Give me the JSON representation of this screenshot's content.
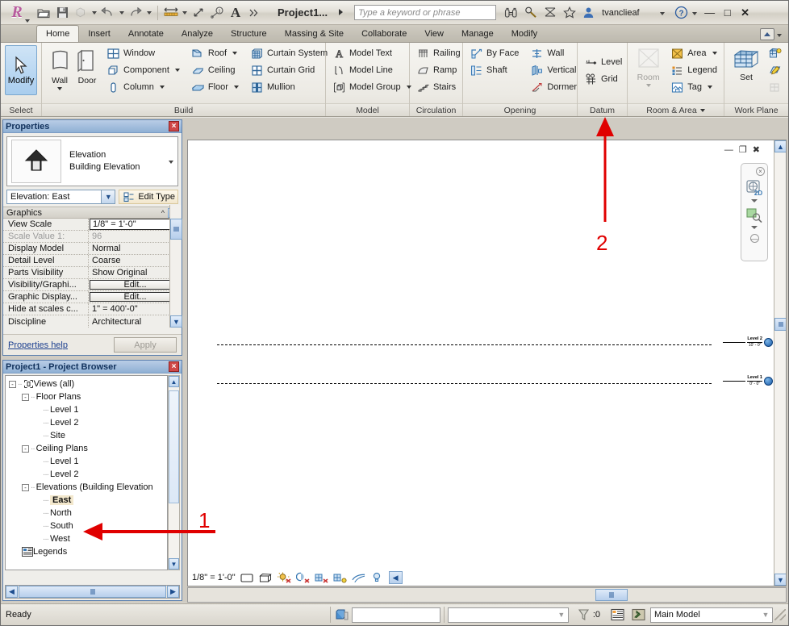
{
  "titlebar": {
    "app_menu": "R",
    "qat": [
      {
        "name": "open-icon",
        "label": "Open"
      },
      {
        "name": "save-icon",
        "label": "Save"
      },
      {
        "name": "sync-icon",
        "label": "Synchronize with Central"
      },
      {
        "name": "undo-icon",
        "label": "Undo"
      },
      {
        "name": "redo-icon",
        "label": "Redo"
      },
      {
        "name": "measure-icon",
        "label": "Measure"
      },
      {
        "name": "aligned-dimension-icon",
        "label": "Aligned Dimension"
      },
      {
        "name": "tag-icon",
        "label": "Tag by Category"
      },
      {
        "name": "text-icon",
        "label": "Text"
      },
      {
        "name": "more-icon",
        "label": "More"
      }
    ],
    "document_title": "Project1...",
    "search_placeholder": "Type a keyword or phrase",
    "icons": [
      {
        "name": "binoculars-icon"
      },
      {
        "name": "search-icon"
      },
      {
        "name": "subscription-icon"
      },
      {
        "name": "star-icon"
      }
    ],
    "user": "tvanclieaf",
    "help_label": "?",
    "window_buttons": [
      "minimize",
      "maximize",
      "close"
    ]
  },
  "tabs": [
    {
      "label": "Home",
      "active": true
    },
    {
      "label": "Insert",
      "active": false
    },
    {
      "label": "Annotate",
      "active": false
    },
    {
      "label": "Analyze",
      "active": false
    },
    {
      "label": "Structure",
      "active": false
    },
    {
      "label": "Massing & Site",
      "active": false
    },
    {
      "label": "Collaborate",
      "active": false
    },
    {
      "label": "View",
      "active": false
    },
    {
      "label": "Manage",
      "active": false
    },
    {
      "label": "Modify",
      "active": false
    }
  ],
  "ribbon": {
    "panels": [
      {
        "title": "Select",
        "big": [
          {
            "label": "Modify",
            "icon": "cursor-icon",
            "active": true
          }
        ],
        "columns": []
      },
      {
        "title": "Build",
        "big": [
          {
            "label": "Wall",
            "icon": "wall-icon",
            "dropdown": true
          },
          {
            "label": "Door",
            "icon": "door-icon",
            "dropdown": false
          }
        ],
        "columns": [
          [
            {
              "label": "Window",
              "icon": "window-icon",
              "dropdown": false
            },
            {
              "label": "Component",
              "icon": "component-icon",
              "dropdown": true
            },
            {
              "label": "Column",
              "icon": "column-icon",
              "dropdown": true
            }
          ],
          [
            {
              "label": "Roof",
              "icon": "roof-icon",
              "dropdown": true
            },
            {
              "label": "Ceiling",
              "icon": "ceiling-icon",
              "dropdown": false
            },
            {
              "label": "Floor",
              "icon": "floor-icon",
              "dropdown": true
            }
          ],
          [
            {
              "label": "Curtain System",
              "icon": "curtain-system-icon",
              "dropdown": false
            },
            {
              "label": "Curtain Grid",
              "icon": "curtain-grid-icon",
              "dropdown": false
            },
            {
              "label": "Mullion",
              "icon": "mullion-icon",
              "dropdown": false
            }
          ]
        ]
      },
      {
        "title": "Model",
        "big": [],
        "columns": [
          [
            {
              "label": "Model Text",
              "icon": "model-text-icon",
              "dropdown": false
            },
            {
              "label": "Model Line",
              "icon": "model-line-icon",
              "dropdown": false
            },
            {
              "label": "Model Group",
              "icon": "model-group-icon",
              "dropdown": true
            }
          ]
        ]
      },
      {
        "title": "Circulation",
        "big": [],
        "columns": [
          [
            {
              "label": "Railing",
              "icon": "railing-icon",
              "dropdown": false
            },
            {
              "label": "Ramp",
              "icon": "ramp-icon",
              "dropdown": false
            },
            {
              "label": "Stairs",
              "icon": "stairs-icon",
              "dropdown": false
            }
          ]
        ]
      },
      {
        "title": "Opening",
        "big": [],
        "columns": [
          [
            {
              "label": "By Face",
              "icon": "by-face-icon",
              "dropdown": false
            },
            {
              "label": "Shaft",
              "icon": "shaft-icon",
              "dropdown": false
            }
          ],
          [
            {
              "label": "Wall",
              "icon": "wall-opening-icon",
              "dropdown": false
            },
            {
              "label": "Vertical",
              "icon": "vertical-opening-icon",
              "dropdown": false
            },
            {
              "label": "Dormer",
              "icon": "dormer-icon",
              "dropdown": false
            }
          ]
        ]
      },
      {
        "title": "Datum",
        "big": [],
        "columns": [
          [
            {
              "label": "Level",
              "icon": "level-icon",
              "dropdown": false
            },
            {
              "label": "Grid",
              "icon": "grid-icon",
              "dropdown": false
            }
          ]
        ]
      },
      {
        "title": "Room & Area",
        "title_dropdown": true,
        "big": [
          {
            "label": "Room",
            "icon": "room-icon",
            "dropdown": true,
            "disabled": true
          }
        ],
        "columns": [
          [
            {
              "label": "Area",
              "icon": "area-icon",
              "dropdown": true
            },
            {
              "label": "Legend",
              "icon": "legend-icon",
              "dropdown": false
            },
            {
              "label": "Tag",
              "icon": "tag-icon",
              "dropdown": true
            }
          ]
        ]
      },
      {
        "title": "Work Plane",
        "big": [
          {
            "label": "Set",
            "icon": "set-workplane-icon",
            "dropdown": false
          }
        ],
        "columns": [
          [
            {
              "label": "",
              "icon": "show-workplane-icon",
              "dropdown": false
            },
            {
              "label": "",
              "icon": "workplane-viewer-icon",
              "dropdown": false
            },
            {
              "label": "",
              "icon": "ref-plane-icon",
              "dropdown": false,
              "disabled": true
            }
          ]
        ]
      }
    ]
  },
  "properties": {
    "title": "Properties",
    "close_label": "×",
    "type_family": "Elevation",
    "type_name": "Building Elevation",
    "instance_selector": "Elevation: East",
    "edit_type_label": "Edit Type",
    "group_header": "Graphics",
    "rows": [
      {
        "key": "View Scale",
        "value": "1/8\" = 1'-0\"",
        "state": "selected"
      },
      {
        "key": "Scale Value    1:",
        "value": "96",
        "state": "gray"
      },
      {
        "key": "Display Model",
        "value": "Normal",
        "state": "normal"
      },
      {
        "key": "Detail Level",
        "value": "Coarse",
        "state": "normal"
      },
      {
        "key": "Parts Visibility",
        "value": "Show Original",
        "state": "normal"
      },
      {
        "key": "Visibility/Graphi...",
        "value": "Edit...",
        "state": "button"
      },
      {
        "key": "Graphic Display...",
        "value": "Edit...",
        "state": "button"
      },
      {
        "key": "Hide at scales c...",
        "value": "1\" = 400'-0\"",
        "state": "normal"
      },
      {
        "key": "Discipline",
        "value": "Architectural",
        "state": "normal"
      }
    ],
    "help_link": "Properties help",
    "apply_label": "Apply"
  },
  "browser": {
    "title": "Project1 - Project Browser",
    "close_label": "×",
    "nodes": [
      {
        "label": "Views (all)",
        "depth": 0,
        "toggle": "-",
        "icon": "views-icon",
        "selected": false
      },
      {
        "label": "Floor Plans",
        "depth": 1,
        "toggle": "-",
        "icon": "",
        "selected": false
      },
      {
        "label": "Level 1",
        "depth": 2,
        "toggle": "",
        "icon": "",
        "selected": false
      },
      {
        "label": "Level 2",
        "depth": 2,
        "toggle": "",
        "icon": "",
        "selected": false
      },
      {
        "label": "Site",
        "depth": 2,
        "toggle": "",
        "icon": "",
        "selected": false
      },
      {
        "label": "Ceiling Plans",
        "depth": 1,
        "toggle": "-",
        "icon": "",
        "selected": false
      },
      {
        "label": "Level 1",
        "depth": 2,
        "toggle": "",
        "icon": "",
        "selected": false
      },
      {
        "label": "Level 2",
        "depth": 2,
        "toggle": "",
        "icon": "",
        "selected": false
      },
      {
        "label": "Elevations (Building Elevation",
        "depth": 1,
        "toggle": "-",
        "icon": "",
        "selected": false
      },
      {
        "label": "East",
        "depth": 2,
        "toggle": "",
        "icon": "",
        "selected": true
      },
      {
        "label": "North",
        "depth": 2,
        "toggle": "",
        "icon": "",
        "selected": false
      },
      {
        "label": "South",
        "depth": 2,
        "toggle": "",
        "icon": "",
        "selected": false
      },
      {
        "label": "West",
        "depth": 2,
        "toggle": "",
        "icon": "",
        "selected": false
      },
      {
        "label": "Legends",
        "depth": 1,
        "toggle": "",
        "icon": "legends-icon",
        "selected": false
      }
    ]
  },
  "canvas": {
    "levels": [
      {
        "name": "Level 2",
        "elevation": "10' - 0\""
      },
      {
        "name": "Level 1",
        "elevation": "0' - 0\""
      }
    ],
    "navbar": {
      "close_label": "×",
      "items": [
        {
          "name": "steering-wheel-2d-icon",
          "label": "2D"
        },
        {
          "name": "zoom-tool-icon",
          "label": ""
        }
      ],
      "bottom_label": "—"
    },
    "window_controls": [
      {
        "name": "view-minimize-icon"
      },
      {
        "name": "view-restore-icon"
      },
      {
        "name": "view-close-icon"
      }
    ]
  },
  "viewcontrol": {
    "scale": "1/8\" = 1'-0\"",
    "icons": [
      {
        "name": "detail-level-icon"
      },
      {
        "name": "visual-style-icon"
      },
      {
        "name": "sun-path-icon"
      },
      {
        "name": "shadows-icon"
      },
      {
        "name": "render-dialog-icon"
      },
      {
        "name": "crop-view-icon"
      },
      {
        "name": "show-crop-region-icon"
      },
      {
        "name": "temporary-hide-isolate-icon"
      },
      {
        "name": "reveal-hidden-elements-icon"
      },
      {
        "name": "expand-view-bar-icon"
      }
    ]
  },
  "statusbar": {
    "message": "Ready",
    "press_tab_icon": "press-tab-icon",
    "filter_count": ":0",
    "worksets_icon": "worksets-icon",
    "design-options-icon": "design-options-icon",
    "model_selector": "Main Model"
  },
  "annotations": [
    {
      "number": "1",
      "color": "#e00000",
      "direction": "left",
      "target": "browser-east-item"
    },
    {
      "number": "2",
      "color": "#e00000",
      "direction": "up",
      "target": "ribbon-datum-panel"
    }
  ],
  "colors": {
    "accent": "#8fb0d4",
    "annotation": "#e00000",
    "selection": "#f3e8cd",
    "ribbon_active": "#a9cdee"
  }
}
